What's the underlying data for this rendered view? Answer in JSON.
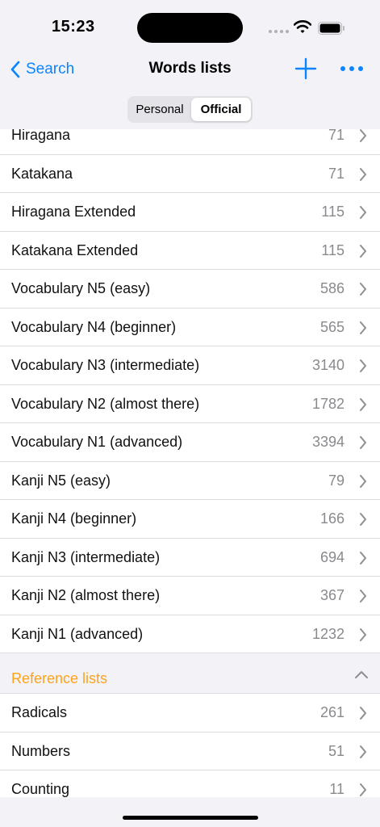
{
  "status_bar": {
    "time": "15:23"
  },
  "nav": {
    "back_label": "Search",
    "title": "Words lists"
  },
  "segmented": {
    "options": [
      "Personal",
      "Official"
    ],
    "selected": "Official"
  },
  "official_lists": [
    {
      "name": "Hiragana",
      "count": "71"
    },
    {
      "name": "Katakana",
      "count": "71"
    },
    {
      "name": "Hiragana Extended",
      "count": "115"
    },
    {
      "name": "Katakana Extended",
      "count": "115"
    },
    {
      "name": "Vocabulary N5 (easy)",
      "count": "586"
    },
    {
      "name": "Vocabulary N4 (beginner)",
      "count": "565"
    },
    {
      "name": "Vocabulary N3 (intermediate)",
      "count": "3140"
    },
    {
      "name": "Vocabulary N2 (almost there)",
      "count": "1782"
    },
    {
      "name": "Vocabulary N1 (advanced)",
      "count": "3394"
    },
    {
      "name": "Kanji N5 (easy)",
      "count": "79"
    },
    {
      "name": "Kanji N4 (beginner)",
      "count": "166"
    },
    {
      "name": "Kanji N3 (intermediate)",
      "count": "694"
    },
    {
      "name": "Kanji N2 (almost there)",
      "count": "367"
    },
    {
      "name": "Kanji N1 (advanced)",
      "count": "1232"
    }
  ],
  "reference_section": {
    "title": "Reference lists",
    "items": [
      {
        "name": "Radicals",
        "count": "261"
      },
      {
        "name": "Numbers",
        "count": "51"
      },
      {
        "name": "Counting",
        "count": "11"
      }
    ]
  },
  "colors": {
    "accent": "#0a84ff",
    "section_title": "#ffa31a",
    "count": "#8a8a8e",
    "background": "#f2f2f7"
  }
}
